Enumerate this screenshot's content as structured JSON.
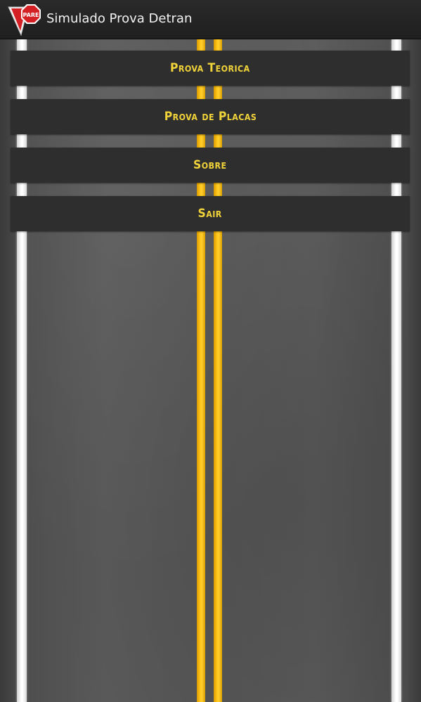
{
  "action_bar": {
    "title": "Simulado Prova Detran",
    "icon": "stop-sign-icon",
    "icon_text": "PARE"
  },
  "menu": {
    "items": [
      {
        "id": "prova-teorica",
        "label": "Prova Teorica"
      },
      {
        "id": "prova-de-placas",
        "label": "Prova de Placas"
      },
      {
        "id": "sobre",
        "label": "Sobre"
      },
      {
        "id": "sair",
        "label": "Sair"
      }
    ]
  },
  "colors": {
    "action_bar": "#222222",
    "button_bg": "#2e2e2e",
    "button_text": "#f1d33a",
    "asphalt": "#565656",
    "center_line": "#ffc61a",
    "edge_line": "#ffffff",
    "stop_sign": "#d42024"
  }
}
